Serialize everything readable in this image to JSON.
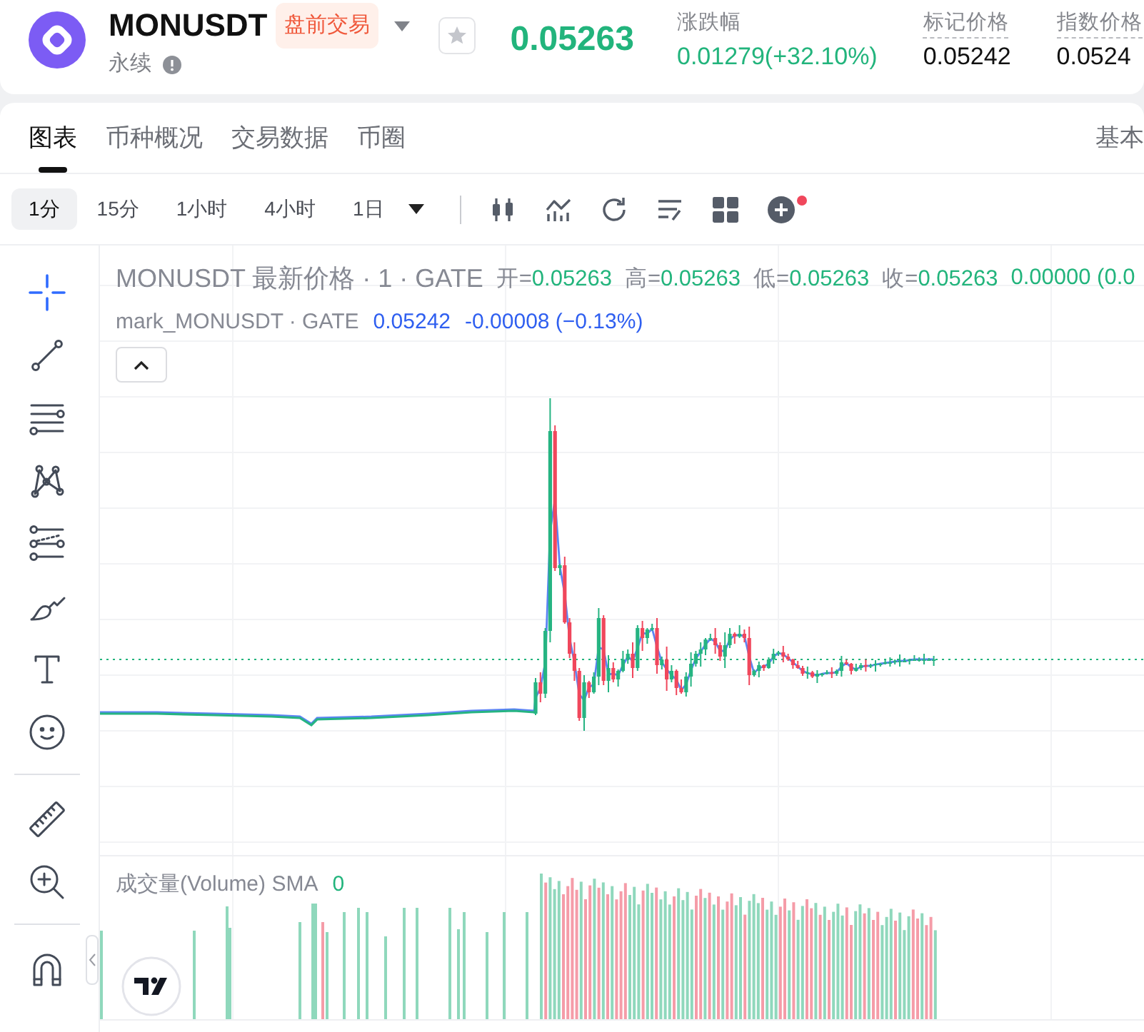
{
  "header": {
    "symbol": "MONUSDT",
    "badge": "盘前交易",
    "contract_type": "永续",
    "favorite": false,
    "last_price": "0.05263",
    "stats": [
      {
        "kind": "change",
        "label": "涨跌幅",
        "value": "0.01279(+32.10%)"
      },
      {
        "kind": "price",
        "label": "标记价格",
        "value": "0.05242"
      },
      {
        "kind": "price",
        "label": "指数价格",
        "value": "0.0524"
      }
    ]
  },
  "tabs": [
    {
      "label": "图表",
      "selected": true
    },
    {
      "label": "币种概况",
      "selected": false
    },
    {
      "label": "交易数据",
      "selected": false
    },
    {
      "label": "币圈",
      "selected": false
    }
  ],
  "view_mode": "基本",
  "intervals": [
    {
      "label": "1分",
      "selected": true
    },
    {
      "label": "15分",
      "selected": false
    },
    {
      "label": "1小时",
      "selected": false
    },
    {
      "label": "4小时",
      "selected": false
    },
    {
      "label": "1日",
      "selected": false
    }
  ],
  "chart_toolbar": {
    "notification_dot": true
  },
  "drawing_tools": [
    {
      "tools": [
        {
          "kind": "crosshair",
          "selected": true
        },
        {
          "kind": "trend_line",
          "selected": false
        },
        {
          "kind": "fib_lines",
          "selected": false
        },
        {
          "kind": "pattern",
          "selected": false
        },
        {
          "kind": "channel",
          "selected": false
        },
        {
          "kind": "brush",
          "selected": false
        },
        {
          "kind": "text",
          "selected": false
        },
        {
          "kind": "emoji",
          "selected": false
        }
      ]
    },
    {
      "tools": [
        {
          "kind": "ruler",
          "selected": false
        },
        {
          "kind": "zoom_in",
          "selected": false
        }
      ]
    },
    {
      "tools": [
        {
          "kind": "magnet",
          "selected": false
        }
      ]
    }
  ],
  "legend": {
    "title": "MONUSDT 最新价格 · 1 · GATE",
    "ohlc": [
      {
        "label": "开=",
        "value": "0.05263"
      },
      {
        "label": "高=",
        "value": "0.05263"
      },
      {
        "label": "低=",
        "value": "0.05263"
      },
      {
        "label": "收=",
        "value": "0.05263"
      }
    ],
    "change": "0.00000 (0.0"
  },
  "mark_legend": {
    "title": "mark_MONUSDT · GATE",
    "value": "0.05242",
    "change": "-0.00008 (−0.13%)"
  },
  "volume_legend": {
    "title": "成交量(Volume) SMA",
    "value": "0"
  }
}
